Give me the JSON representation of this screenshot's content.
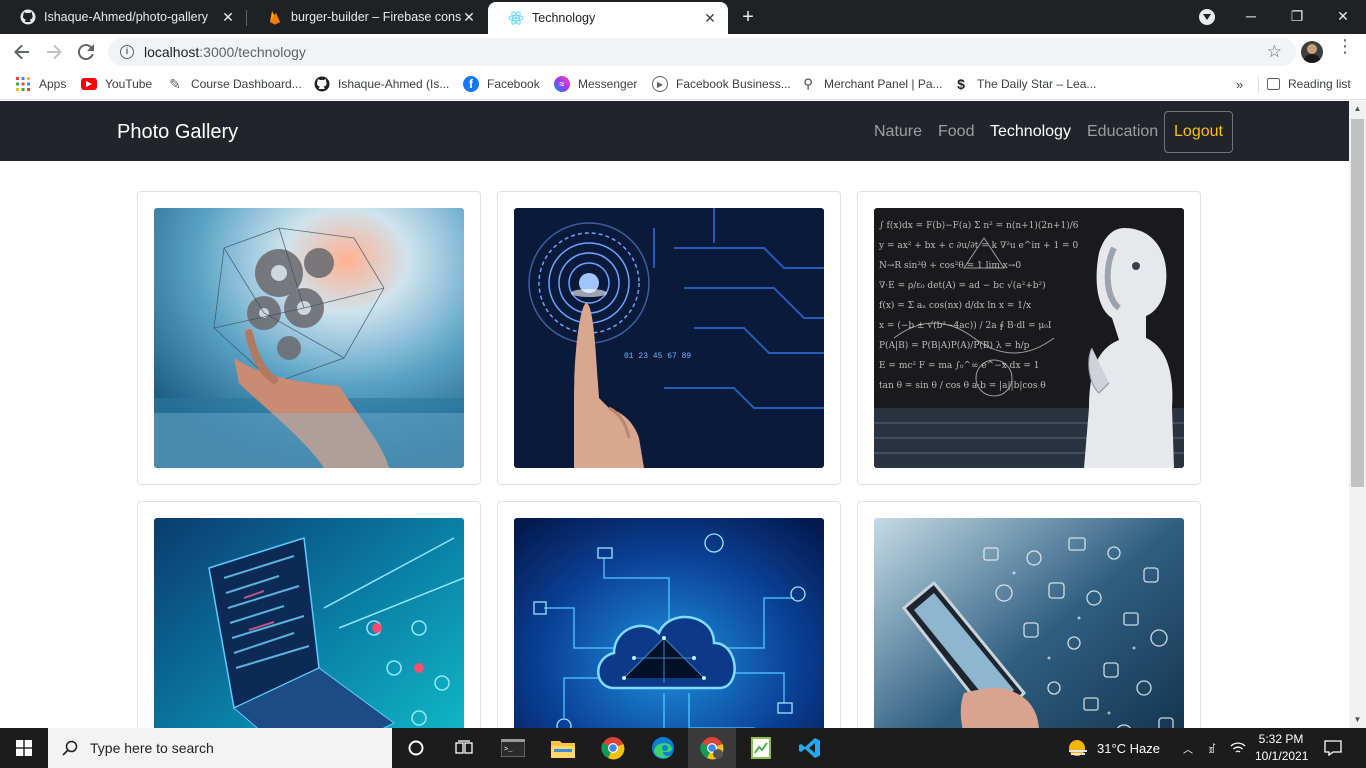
{
  "browser": {
    "tabs": [
      {
        "title": "Ishaque-Ahmed/photo-gallery",
        "icon": "github-icon",
        "active": false
      },
      {
        "title": "burger-builder – Firebase console",
        "icon": "firebase-icon",
        "active": false
      },
      {
        "title": "Technology",
        "icon": "react-icon",
        "active": true
      }
    ],
    "url_host": "localhost",
    "url_path": ":3000/technology",
    "bookmarks": [
      {
        "label": "Apps",
        "icon": "apps-grid-icon"
      },
      {
        "label": "YouTube",
        "icon": "youtube-icon"
      },
      {
        "label": "Course Dashboard...",
        "icon": "course-icon"
      },
      {
        "label": "Ishaque-Ahmed (Is...",
        "icon": "github-icon"
      },
      {
        "label": "Facebook",
        "icon": "facebook-icon"
      },
      {
        "label": "Messenger",
        "icon": "messenger-icon"
      },
      {
        "label": "Facebook Business...",
        "icon": "facebook-business-icon"
      },
      {
        "label": "Merchant Panel | Pa...",
        "icon": "merchant-icon"
      },
      {
        "label": "The Daily Star – Lea...",
        "icon": "daily-star-icon"
      }
    ],
    "more_bookmarks": "»",
    "reading_list": "Reading list"
  },
  "page": {
    "brand": "Photo Gallery",
    "nav": [
      {
        "label": "Nature",
        "active": false
      },
      {
        "label": "Food",
        "active": false
      },
      {
        "label": "Technology",
        "active": true
      },
      {
        "label": "Education",
        "active": false
      }
    ],
    "logout": "Logout",
    "photos": [
      {
        "subject": "hand holding gears and network"
      },
      {
        "subject": "fingerprint touch circuit"
      },
      {
        "subject": "robot with formulas blackboard"
      },
      {
        "subject": "laptop with code and circuit"
      },
      {
        "subject": "cloud computing network"
      },
      {
        "subject": "smartphone with app icons"
      }
    ]
  },
  "taskbar": {
    "search_placeholder": "Type here to search",
    "weather": "31°C  Haze",
    "time": "5:32 PM",
    "date": "10/1/2021"
  },
  "colors": {
    "navbar_bg": "#212529",
    "logout_text": "#ffc107",
    "tabstrip_bg": "#202124",
    "taskbar_bg": "#1c1c1c"
  }
}
